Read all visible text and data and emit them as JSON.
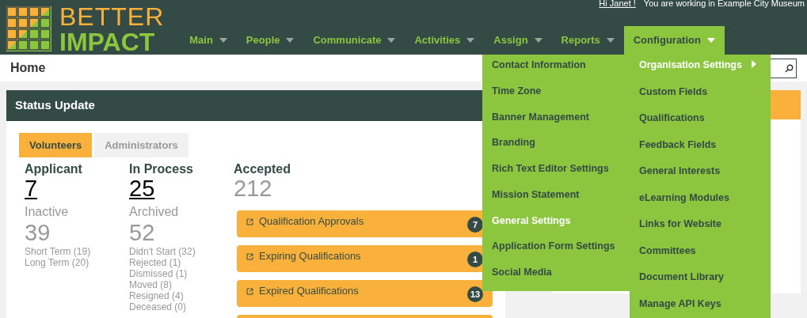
{
  "header": {
    "logo": {
      "line1": "BETTER",
      "line2": "IMPACT"
    },
    "greeting": "Hi Janet !",
    "context": "You are working in Example City Museum",
    "nav": [
      {
        "label": "Main",
        "selected": false
      },
      {
        "label": "People",
        "selected": false
      },
      {
        "label": "Communicate",
        "selected": false
      },
      {
        "label": "Activities",
        "selected": false
      },
      {
        "label": "Assign",
        "selected": false
      },
      {
        "label": "Reports",
        "selected": false
      },
      {
        "label": "Configuration",
        "selected": true
      }
    ]
  },
  "breadcrumb": "Home",
  "menu": {
    "columns": [
      [
        {
          "label": "Contact Information",
          "selected": false,
          "submenu": false
        },
        {
          "label": "Time Zone",
          "selected": false,
          "submenu": false
        },
        {
          "label": "Banner Management",
          "selected": false,
          "submenu": false
        },
        {
          "label": "Branding",
          "selected": false,
          "submenu": false
        },
        {
          "label": "Rich Text Editor Settings",
          "selected": false,
          "submenu": false
        },
        {
          "label": "Mission Statement",
          "selected": false,
          "submenu": false
        },
        {
          "label": "General Settings",
          "selected": true,
          "submenu": false
        },
        {
          "label": "Application Form Settings",
          "selected": false,
          "submenu": false
        },
        {
          "label": "Social Media",
          "selected": false,
          "submenu": false
        }
      ],
      [
        {
          "label": "Organisation Settings",
          "selected": true,
          "submenu": true
        },
        {
          "label": "Custom Fields",
          "selected": false,
          "submenu": false
        },
        {
          "label": "Qualifications",
          "selected": false,
          "submenu": false
        },
        {
          "label": "Feedback Fields",
          "selected": false,
          "submenu": false
        },
        {
          "label": "General Interests",
          "selected": false,
          "submenu": false
        },
        {
          "label": "eLearning Modules",
          "selected": false,
          "submenu": false
        },
        {
          "label": "Links for Website",
          "selected": false,
          "submenu": false
        },
        {
          "label": "Committees",
          "selected": false,
          "submenu": false
        },
        {
          "label": "Document Library",
          "selected": false,
          "submenu": false
        },
        {
          "label": "Manage API Keys",
          "selected": false,
          "submenu": false
        }
      ]
    ]
  },
  "status": {
    "title": "Status Update",
    "tabs": [
      {
        "label": "Volunteers",
        "selected": true
      },
      {
        "label": "Administrators",
        "selected": false
      }
    ],
    "groups": [
      {
        "label": "Applicant",
        "count": "7",
        "sub_label": "Inactive",
        "sub_count": "39",
        "details": [
          "Short Term (19)",
          "Long Term (20)"
        ]
      },
      {
        "label": "In Process",
        "count": "25",
        "sub_label": "Archived",
        "sub_count": "52",
        "details": [
          "Didn't Start (32)",
          "Rejected (1)",
          "Dismissed (1)",
          "Moved (8)",
          "Resigned (4)",
          "Deceased (0)"
        ]
      }
    ],
    "accepted": {
      "label": "Accepted",
      "count": "212"
    },
    "alerts": [
      {
        "label": "Qualification Approvals",
        "count": "7"
      },
      {
        "label": "Expiring Qualifications",
        "count": "1"
      },
      {
        "label": "Expired Qualifications",
        "count": "13"
      }
    ]
  }
}
